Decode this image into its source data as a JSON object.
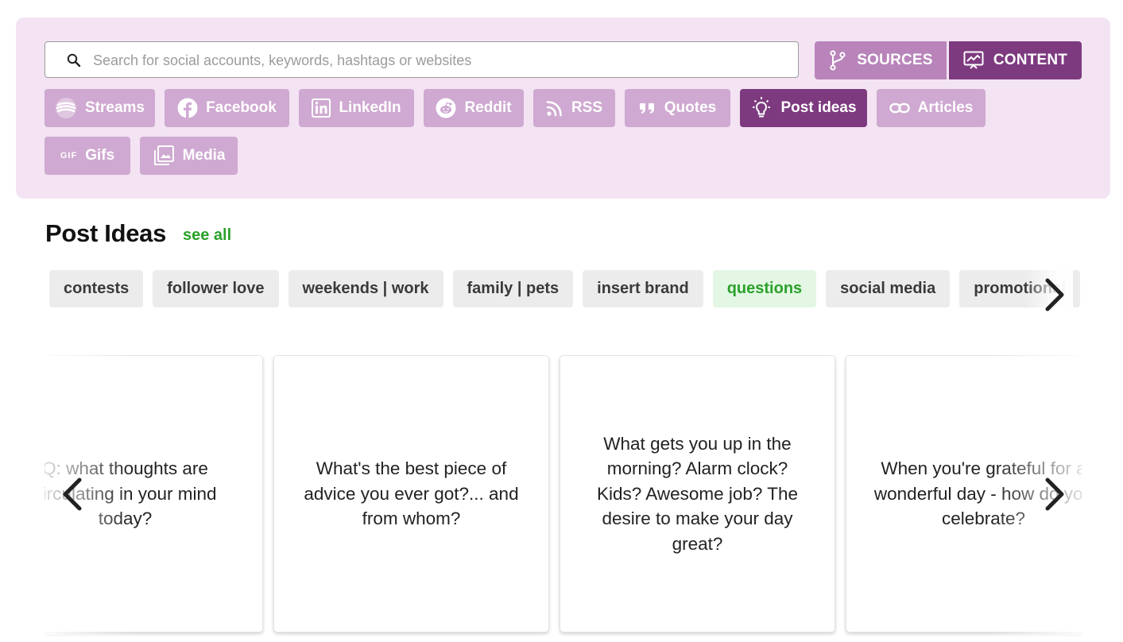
{
  "search": {
    "placeholder": "Search for social accounts, keywords, hashtags or websites",
    "value": ""
  },
  "mode_toggle": {
    "sources_label": "SOURCES",
    "content_label": "CONTENT",
    "active": "CONTENT"
  },
  "categories": [
    {
      "label": "Streams",
      "icon": "streams-icon"
    },
    {
      "label": "Facebook",
      "icon": "facebook-icon"
    },
    {
      "label": "LinkedIn",
      "icon": "linkedin-icon"
    },
    {
      "label": "Reddit",
      "icon": "reddit-icon"
    },
    {
      "label": "RSS",
      "icon": "rss-icon"
    },
    {
      "label": "Quotes",
      "icon": "quotes-icon"
    },
    {
      "label": "Post ideas",
      "icon": "lightbulb-icon",
      "active": true
    },
    {
      "label": "Articles",
      "icon": "link-icon"
    },
    {
      "label": "Gifs",
      "icon": "gif-icon"
    },
    {
      "label": "Media",
      "icon": "media-icon"
    }
  ],
  "section": {
    "title": "Post Ideas",
    "see_all": "see all"
  },
  "filter_chips": [
    {
      "label": "contests"
    },
    {
      "label": "follower love"
    },
    {
      "label": "weekends | work"
    },
    {
      "label": "family | pets"
    },
    {
      "label": "insert brand"
    },
    {
      "label": "questions",
      "selected": true
    },
    {
      "label": "social media"
    },
    {
      "label": "promotional"
    }
  ],
  "cards": [
    {
      "text": "Q: what thoughts are circulating in your mind today?"
    },
    {
      "text": "What's the best piece of advice you ever got?... and from whom?"
    },
    {
      "text": "What gets you up in the morning? Alarm clock? Kids? Awesome job? The desire to make your day great?"
    },
    {
      "text": "When you're grateful for a wonderful day - how do you celebrate?"
    }
  ],
  "colors": {
    "panel_bg": "#f3e3f3",
    "category_btn": "#cfa9d1",
    "active_purple": "#7d3a7f",
    "sources_btn": "#b884ba",
    "accent_green": "#2aa12a",
    "chip_bg": "#ececec",
    "chip_selected_bg": "#e4f7e4"
  }
}
